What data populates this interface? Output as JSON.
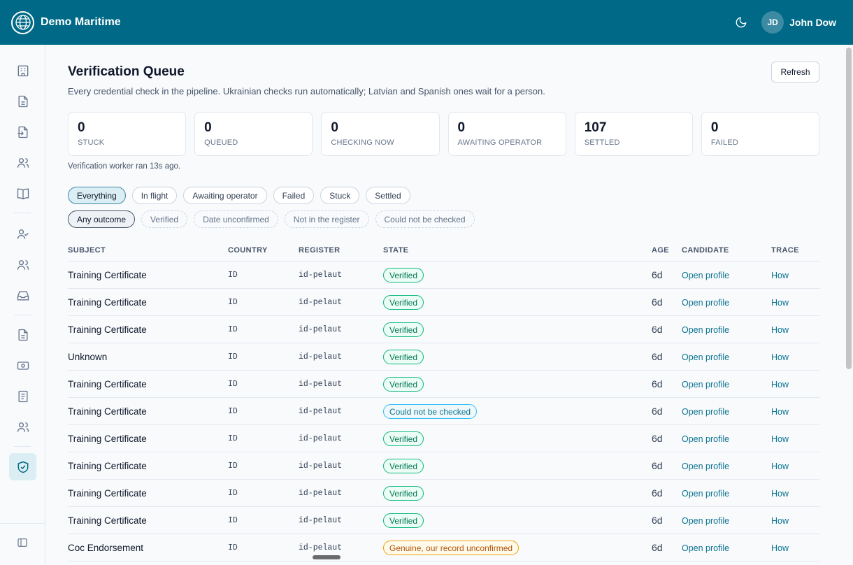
{
  "app": {
    "brand": "Demo Maritime"
  },
  "user": {
    "initials": "JD",
    "name": "John Dow"
  },
  "page": {
    "title": "Verification Queue",
    "subtitle": "Every credential check in the pipeline. Ukrainian checks run automatically; Latvian and Spanish ones wait for a person.",
    "refresh_label": "Refresh",
    "worker_note": "Verification worker ran 13s ago."
  },
  "stats": [
    {
      "value": "0",
      "label": "STUCK"
    },
    {
      "value": "0",
      "label": "QUEUED"
    },
    {
      "value": "0",
      "label": "CHECKING NOW"
    },
    {
      "value": "0",
      "label": "AWAITING OPERATOR"
    },
    {
      "value": "107",
      "label": "SETTLED"
    },
    {
      "value": "0",
      "label": "FAILED"
    }
  ],
  "state_filters": [
    "Everything",
    "In flight",
    "Awaiting operator",
    "Failed",
    "Stuck",
    "Settled"
  ],
  "outcome_filters": [
    "Any outcome",
    "Verified",
    "Date unconfirmed",
    "Not in the register",
    "Could not be checked"
  ],
  "table": {
    "headers": [
      "SUBJECT",
      "COUNTRY",
      "REGISTER",
      "STATE",
      "AGE",
      "CANDIDATE",
      "TRACE"
    ],
    "rows": [
      {
        "subject": "Training Certificate",
        "country": "ID",
        "register": "id-pelaut",
        "state": "Verified",
        "age": "6d",
        "candidate": "Open profile",
        "trace": "How"
      },
      {
        "subject": "Training Certificate",
        "country": "ID",
        "register": "id-pelaut",
        "state": "Verified",
        "age": "6d",
        "candidate": "Open profile",
        "trace": "How"
      },
      {
        "subject": "Training Certificate",
        "country": "ID",
        "register": "id-pelaut",
        "state": "Verified",
        "age": "6d",
        "candidate": "Open profile",
        "trace": "How"
      },
      {
        "subject": "Unknown",
        "country": "ID",
        "register": "id-pelaut",
        "state": "Verified",
        "age": "6d",
        "candidate": "Open profile",
        "trace": "How"
      },
      {
        "subject": "Training Certificate",
        "country": "ID",
        "register": "id-pelaut",
        "state": "Verified",
        "age": "6d",
        "candidate": "Open profile",
        "trace": "How"
      },
      {
        "subject": "Training Certificate",
        "country": "ID",
        "register": "id-pelaut",
        "state": "Could not be checked",
        "age": "6d",
        "candidate": "Open profile",
        "trace": "How"
      },
      {
        "subject": "Training Certificate",
        "country": "ID",
        "register": "id-pelaut",
        "state": "Verified",
        "age": "6d",
        "candidate": "Open profile",
        "trace": "How"
      },
      {
        "subject": "Training Certificate",
        "country": "ID",
        "register": "id-pelaut",
        "state": "Verified",
        "age": "6d",
        "candidate": "Open profile",
        "trace": "How"
      },
      {
        "subject": "Training Certificate",
        "country": "ID",
        "register": "id-pelaut",
        "state": "Verified",
        "age": "6d",
        "candidate": "Open profile",
        "trace": "How"
      },
      {
        "subject": "Training Certificate",
        "country": "ID",
        "register": "id-pelaut",
        "state": "Verified",
        "age": "6d",
        "candidate": "Open profile",
        "trace": "How"
      },
      {
        "subject": "Coc Endorsement",
        "country": "ID",
        "register": "id-pelaut",
        "state": "Genuine, our record unconfirmed",
        "age": "6d",
        "candidate": "Open profile",
        "trace": "How"
      }
    ]
  },
  "icons": {
    "brand": "globe-icon",
    "theme": "moon-icon",
    "sidebar": [
      "building-icon",
      "document-icon",
      "file-import-icon",
      "users-icon",
      "book-icon",
      "user-check-icon",
      "users-icon",
      "inbox-icon",
      "document-icon",
      "money-icon",
      "receipt-icon",
      "users-icon",
      "shield-check-icon"
    ],
    "collapse": "sidebar-collapse-icon"
  },
  "colors": {
    "header": "#006987",
    "accent": "#0e7490"
  }
}
